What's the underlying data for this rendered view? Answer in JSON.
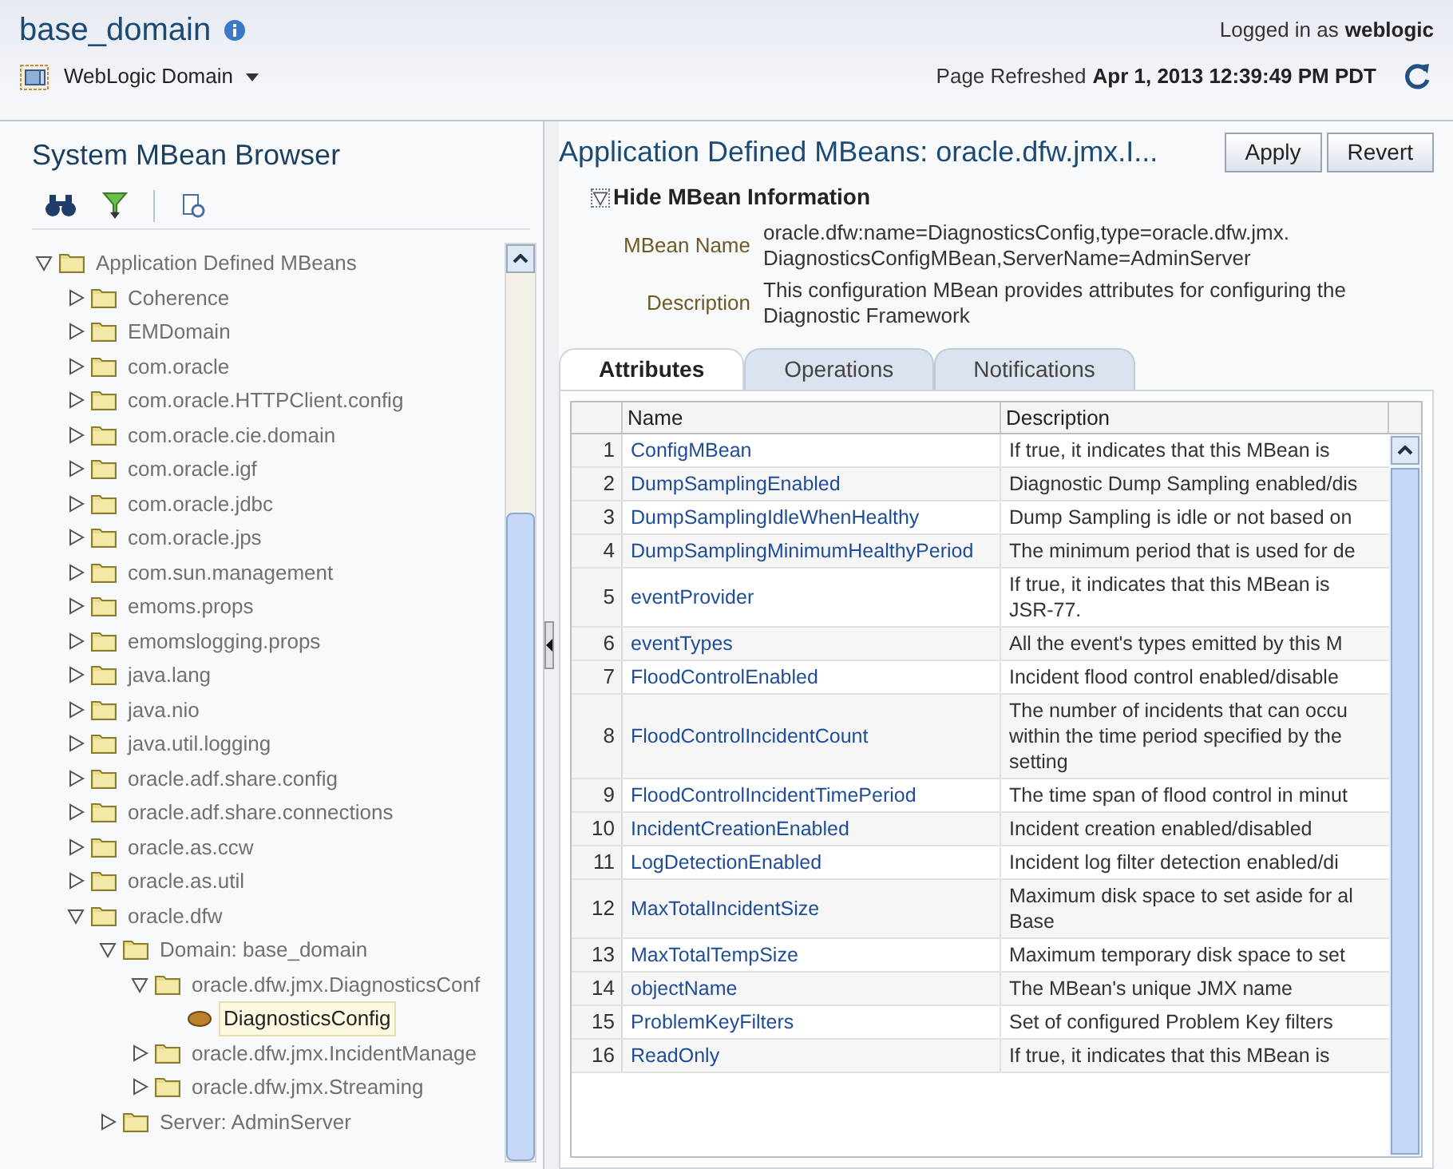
{
  "header": {
    "title": "base_domain",
    "user_label": "Logged in as",
    "user": "weblogic",
    "menu_label": "WebLogic Domain",
    "refreshed_label": "Page Refreshed",
    "refreshed_time": "Apr 1, 2013 12:39:49 PM PDT"
  },
  "browser": {
    "title": "System MBean Browser",
    "tree": [
      {
        "label": "Application Defined MBeans",
        "kind": "folder",
        "expanded": true,
        "selected": false,
        "children": [
          {
            "label": "Coherence",
            "kind": "folder",
            "expanded": false,
            "selected": false
          },
          {
            "label": "EMDomain",
            "kind": "folder",
            "expanded": false,
            "selected": false
          },
          {
            "label": "com.oracle",
            "kind": "folder",
            "expanded": false,
            "selected": false
          },
          {
            "label": "com.oracle.HTTPClient.config",
            "kind": "folder",
            "expanded": false,
            "selected": false
          },
          {
            "label": "com.oracle.cie.domain",
            "kind": "folder",
            "expanded": false,
            "selected": false
          },
          {
            "label": "com.oracle.igf",
            "kind": "folder",
            "expanded": false,
            "selected": false
          },
          {
            "label": "com.oracle.jdbc",
            "kind": "folder",
            "expanded": false,
            "selected": false
          },
          {
            "label": "com.oracle.jps",
            "kind": "folder",
            "expanded": false,
            "selected": false
          },
          {
            "label": "com.sun.management",
            "kind": "folder",
            "expanded": false,
            "selected": false
          },
          {
            "label": "emoms.props",
            "kind": "folder",
            "expanded": false,
            "selected": false
          },
          {
            "label": "emomslogging.props",
            "kind": "folder",
            "expanded": false,
            "selected": false
          },
          {
            "label": "java.lang",
            "kind": "folder",
            "expanded": false,
            "selected": false
          },
          {
            "label": "java.nio",
            "kind": "folder",
            "expanded": false,
            "selected": false
          },
          {
            "label": "java.util.logging",
            "kind": "folder",
            "expanded": false,
            "selected": false
          },
          {
            "label": "oracle.adf.share.config",
            "kind": "folder",
            "expanded": false,
            "selected": false
          },
          {
            "label": "oracle.adf.share.connections",
            "kind": "folder",
            "expanded": false,
            "selected": false
          },
          {
            "label": "oracle.as.ccw",
            "kind": "folder",
            "expanded": false,
            "selected": false
          },
          {
            "label": "oracle.as.util",
            "kind": "folder",
            "expanded": false,
            "selected": false
          },
          {
            "label": "oracle.dfw",
            "kind": "folder",
            "expanded": true,
            "selected": false,
            "children": [
              {
                "label": "Domain: base_domain",
                "kind": "folder",
                "expanded": true,
                "selected": false,
                "children": [
                  {
                    "label": "oracle.dfw.jmx.DiagnosticsConf",
                    "kind": "folder",
                    "expanded": true,
                    "selected": false,
                    "children": [
                      {
                        "label": "DiagnosticsConfig",
                        "kind": "mbean",
                        "selected": true
                      }
                    ]
                  },
                  {
                    "label": "oracle.dfw.jmx.IncidentManage",
                    "kind": "folder",
                    "expanded": false,
                    "selected": false
                  },
                  {
                    "label": "oracle.dfw.jmx.Streaming",
                    "kind": "folder",
                    "expanded": false,
                    "selected": false
                  }
                ]
              },
              {
                "label": "Server: AdminServer",
                "kind": "folder",
                "expanded": false,
                "selected": false
              }
            ]
          }
        ]
      }
    ]
  },
  "detail": {
    "title": "Application Defined MBeans: oracle.dfw.jmx.I...",
    "buttons": [
      "Apply",
      "Revert"
    ],
    "info_toggle": {
      "label": "Hide MBean Information",
      "expanded": true
    },
    "info": [
      {
        "label": "MBean Name",
        "value": "oracle.dfw:name=DiagnosticsConfig,type=oracle.dfw.jmx.\nDiagnosticsConfigMBean,ServerName=AdminServer"
      },
      {
        "label": "Description",
        "value": "This configuration MBean provides attributes for configuring the\nDiagnostic Framework"
      }
    ],
    "tabs": [
      {
        "label": "Attributes",
        "selected": true
      },
      {
        "label": "Operations",
        "selected": false
      },
      {
        "label": "Notifications",
        "selected": false
      }
    ],
    "table": {
      "columns": [
        "Name",
        "Description"
      ],
      "rows": [
        {
          "index": "1",
          "name": "ConfigMBean",
          "description": "If true, it indicates that this MBean is"
        },
        {
          "index": "2",
          "name": "DumpSamplingEnabled",
          "description": "Diagnostic Dump Sampling enabled/dis"
        },
        {
          "index": "3",
          "name": "DumpSamplingIdleWhenHealthy",
          "description": "Dump Sampling is idle or not based on"
        },
        {
          "index": "4",
          "name": "DumpSamplingMinimumHealthyPeriod",
          "description": "The minimum period that is used for de"
        },
        {
          "index": "5",
          "name": "eventProvider",
          "description": "If true, it indicates that this MBean is\nJSR-77."
        },
        {
          "index": "6",
          "name": "eventTypes",
          "description": "All the event's types emitted by this M"
        },
        {
          "index": "7",
          "name": "FloodControlEnabled",
          "description": "Incident flood control enabled/disable"
        },
        {
          "index": "8",
          "name": "FloodControlIncidentCount",
          "description": "The number of incidents that can occu\nwithin the time period specified by the\nsetting"
        },
        {
          "index": "9",
          "name": "FloodControlIncidentTimePeriod",
          "description": "The time span of flood control in minut"
        },
        {
          "index": "10",
          "name": "IncidentCreationEnabled",
          "description": "Incident creation enabled/disabled"
        },
        {
          "index": "11",
          "name": "LogDetectionEnabled",
          "description": "Incident log filter detection enabled/di"
        },
        {
          "index": "12",
          "name": "MaxTotalIncidentSize",
          "description": "Maximum disk space to set aside for al\nBase"
        },
        {
          "index": "13",
          "name": "MaxTotalTempSize",
          "description": "Maximum temporary disk space to set"
        },
        {
          "index": "14",
          "name": "objectName",
          "description": "The MBean's unique JMX name"
        },
        {
          "index": "15",
          "name": "ProblemKeyFilters",
          "description": "Set of configured Problem Key filters"
        },
        {
          "index": "16",
          "name": "ReadOnly",
          "description": "If true, it indicates that this MBean is"
        }
      ]
    }
  }
}
